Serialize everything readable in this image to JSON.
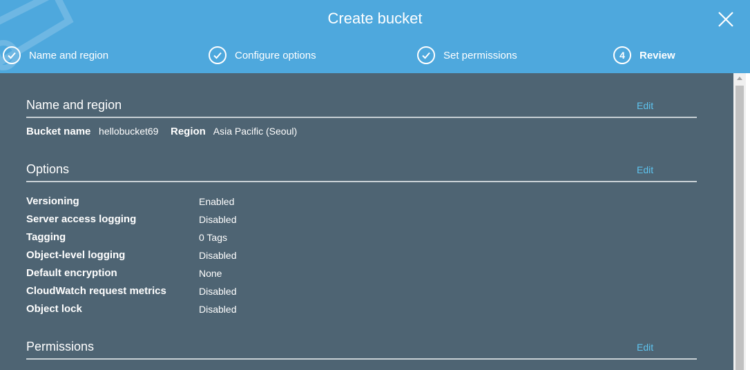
{
  "header": {
    "title": "Create bucket",
    "steps": [
      {
        "label": "Name and region",
        "state": "done",
        "icon": "check-icon"
      },
      {
        "label": "Configure options",
        "state": "done",
        "icon": "check-icon"
      },
      {
        "label": "Set permissions",
        "state": "done",
        "icon": "check-icon"
      },
      {
        "label": "Review",
        "state": "active",
        "number": "4"
      }
    ]
  },
  "sections": {
    "name_region": {
      "title": "Name and region",
      "edit_label": "Edit",
      "bucket_name_label": "Bucket name",
      "bucket_name_value": "hellobucket69",
      "region_label": "Region",
      "region_value": "Asia Pacific (Seoul)"
    },
    "options": {
      "title": "Options",
      "edit_label": "Edit",
      "rows": [
        {
          "key": "Versioning",
          "value": "Enabled"
        },
        {
          "key": "Server access logging",
          "value": "Disabled"
        },
        {
          "key": "Tagging",
          "value": "0 Tags"
        },
        {
          "key": "Object-level logging",
          "value": "Disabled"
        },
        {
          "key": "Default encryption",
          "value": "None"
        },
        {
          "key": "CloudWatch request metrics",
          "value": "Disabled"
        },
        {
          "key": "Object lock",
          "value": "Disabled"
        }
      ]
    },
    "permissions": {
      "title": "Permissions",
      "edit_label": "Edit"
    }
  },
  "colors": {
    "header_bg": "#4ea8dd",
    "body_bg": "#4e6473",
    "link": "#5ec4ef"
  }
}
